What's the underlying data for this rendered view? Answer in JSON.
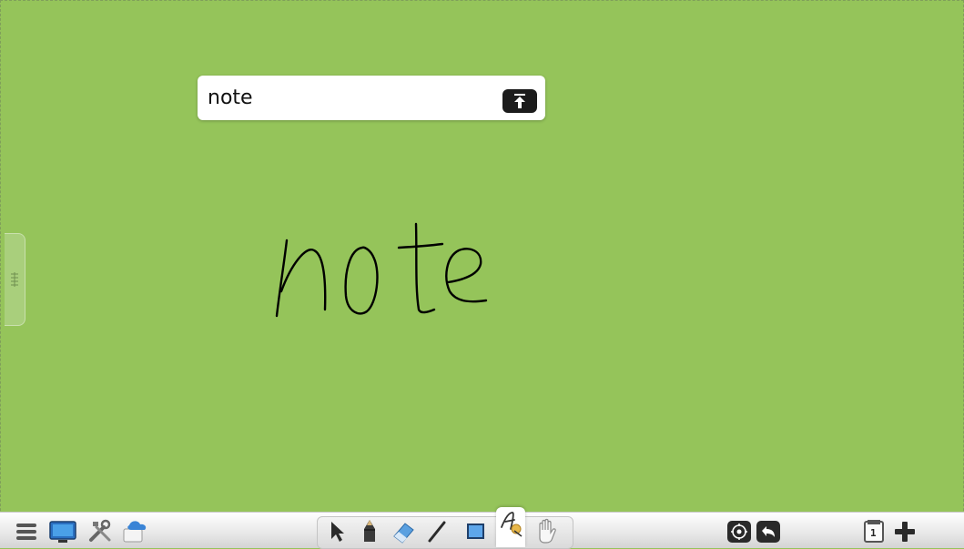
{
  "recognition": {
    "text": "note"
  },
  "toolbar": {
    "left_tools": [
      "menu-icon",
      "monitor-icon",
      "tools-icon",
      "cloud-icon"
    ],
    "center_tools": [
      "select-icon",
      "pencil-icon",
      "eraser-icon",
      "line-icon",
      "rectangle-icon",
      "handwriting-recognition-icon",
      "hand-pan-icon"
    ],
    "active_tool": "handwriting-recognition-icon",
    "right_tools": [
      "locate-icon",
      "undo-icon",
      "page-icon",
      "add-page-icon"
    ],
    "page_number": "1"
  },
  "canvas": {
    "background_color": "#95c45a",
    "ink_color": "#000000"
  }
}
